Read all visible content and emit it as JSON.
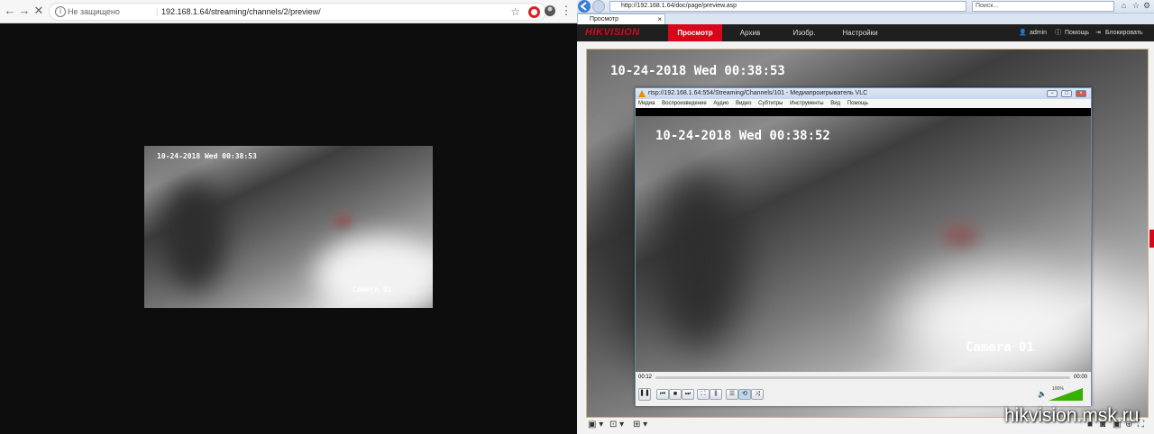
{
  "chrome": {
    "nav_back": "←",
    "nav_forward": "→",
    "nav_stop": "✕",
    "info_icon": "i",
    "security_label": "Не защищено",
    "url": "192.168.1.64/streaming/channels/2/preview/",
    "star": "☆",
    "menu": "⋮",
    "video": {
      "timestamp": "10-24-2018 Wed 00:38:53",
      "camera": "Camera 01"
    }
  },
  "ie": {
    "address": "http://192.168.1.64/doc/page/preview.asp",
    "search_placeholder": "Поиск...",
    "tab_title": "Просмотр",
    "tab_close": "×",
    "window_controls": [
      "−",
      "□",
      "×"
    ]
  },
  "hikvision": {
    "logo": "HIKVISION",
    "nav": [
      "Просмотр",
      "Архив",
      "Изобр.",
      "Настройки"
    ],
    "user": "admin",
    "help": "Помощь",
    "logout": "Блокировать",
    "video": {
      "timestamp": "10-24-2018 Wed 00:38:53"
    },
    "tools": [
      "▣ ▾",
      "⊡ ▾",
      "⊞ ▾"
    ]
  },
  "vlc": {
    "title": "rtsp://192.168.1.64:554/Streaming/Channels/101 - Медиапроигрыватель VLC",
    "menu": [
      "Медиа",
      "Воспроизведение",
      "Аудио",
      "Видео",
      "Субтитры",
      "Инструменты",
      "Вид",
      "Помощь"
    ],
    "time_elapsed": "00:12",
    "time_total": "00:00",
    "volume": "100%",
    "video": {
      "timestamp": "10-24-2018 Wed 00:38:52",
      "camera": "Camera 01"
    }
  },
  "watermark": "hikvision.msk.ru",
  "colors": {
    "hik_red": "#d6071b",
    "chrome_bg": "#0d0d0d"
  }
}
